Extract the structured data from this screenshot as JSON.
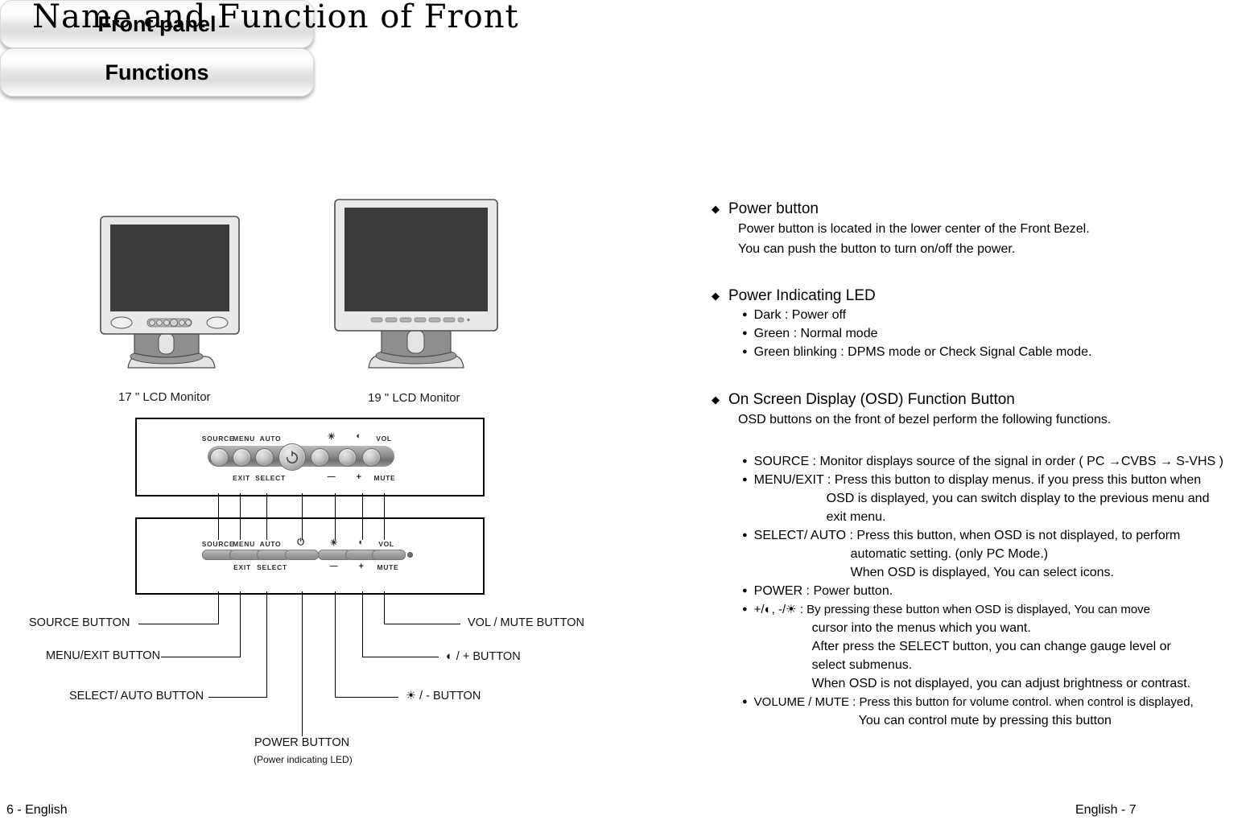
{
  "page": {
    "title": "Name and Function of  Front",
    "footer_left": "6 - English",
    "footer_right": "English - 7"
  },
  "headers": {
    "front_panel": "Front panel",
    "functions": "Functions"
  },
  "monitors": [
    {
      "label": "17 \" LCD Monitor"
    },
    {
      "label": "19 \" LCD Monitor"
    }
  ],
  "panel_buttons": {
    "top_labels": [
      "SOURCE",
      "MENU",
      "AUTO",
      "⏻",
      "☀",
      "◐",
      "VOL"
    ],
    "bottom_labels": [
      "EXIT",
      "SELECT",
      "—",
      "+",
      "MUTE"
    ]
  },
  "callouts": {
    "left": [
      {
        "label": "SOURCE BUTTON"
      },
      {
        "label": "MENU/EXIT BUTTON"
      },
      {
        "label": "SELECT/ AUTO BUTTON"
      }
    ],
    "right": [
      {
        "label": "VOL / MUTE BUTTON"
      },
      {
        "label": "◐ / + BUTTON"
      },
      {
        "label": "☀ / - BUTTON"
      }
    ],
    "power": {
      "label": "POWER  BUTTON",
      "sub": "(Power indicating LED)"
    }
  },
  "functions": {
    "sections": [
      {
        "heading": "Power button",
        "lines": [
          "Power button is located in the lower center of the Front Bezel.",
          "You can push the button to turn on/off the power."
        ],
        "bullets": []
      },
      {
        "heading": "Power Indicating LED",
        "lines": [],
        "bullets": [
          {
            "text": "Dark : Power off",
            "cont": []
          },
          {
            "text": "Green : Normal mode",
            "cont": []
          },
          {
            "text": "Green blinking : DPMS mode or Check Signal Cable mode.",
            "cont": []
          }
        ]
      },
      {
        "heading": "On Screen Display (OSD) Function Button",
        "lines": [
          "OSD buttons on the front of bezel perform the following functions."
        ],
        "bullets": [
          {
            "text": "SOURCE : Monitor displays source of the signal in order ( PC →CVBS → S-VHS )",
            "cont": []
          },
          {
            "text": "MENU/EXIT : Press this button to display menus. if you press this button when",
            "cont": [
              {
                "indent": 90,
                "text": "OSD is displayed, you can switch display to the previous menu and"
              },
              {
                "indent": 90,
                "text": "exit menu."
              }
            ]
          },
          {
            "text": "SELECT/ AUTO : Press this button, when OSD is not displayed, to perform",
            "cont": [
              {
                "indent": 120,
                "text": "automatic setting. (only PC Mode.)"
              },
              {
                "indent": 120,
                "text": "When OSD is displayed, You can select icons."
              }
            ]
          },
          {
            "text": "POWER : Power button.",
            "cont": []
          },
          {
            "text": "+/◐,  -/☀   : By pressing these button when OSD is displayed, You can move",
            "cont": [
              {
                "indent": 72,
                "text": "cursor into  the menus which you want."
              },
              {
                "indent": 72,
                "text": "After press the SELECT button, you can change  gauge level or"
              },
              {
                "indent": 72,
                "text": "select submenus."
              },
              {
                "indent": 72,
                "text": "When OSD is not displayed, you can adjust brightness or contrast."
              }
            ]
          },
          {
            "text": "VOLUME / MUTE : Press this button for volume control. when control is displayed,",
            "cont": [
              {
                "indent": 130,
                "text": "You can control mute by pressing this button"
              }
            ]
          }
        ]
      }
    ]
  },
  "colors": {
    "ink": "#000000",
    "screen": "#3b3b3b",
    "bezel": "#e9e9e9",
    "stand": "#8a8a8a"
  }
}
